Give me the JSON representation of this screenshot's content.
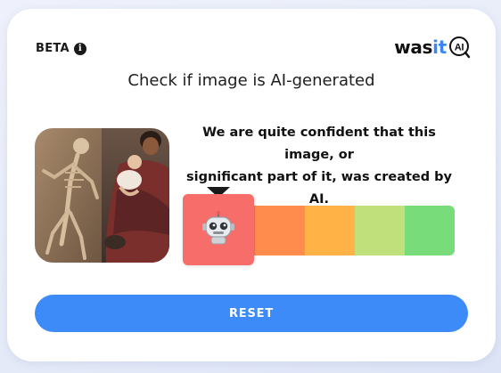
{
  "header": {
    "beta_label": "BETA",
    "info_glyph": "i",
    "logo_part1": "was",
    "logo_part2": "it",
    "logo_badge": "AI"
  },
  "title": "Check if image is AI-generated",
  "result": {
    "verdict_line1": "We are quite confident that this image, or",
    "verdict_line2": "significant part of it, was created by AI.",
    "meter_level": 1,
    "meter_levels_total": 5,
    "meter_colors": [
      "#f76d6a",
      "#ff8c4c",
      "#ffb347",
      "#bfe07a",
      "#78dc7a"
    ],
    "indicator_icon": "robot-icon"
  },
  "image": {
    "icon": "uploaded-image-thumbnail"
  },
  "actions": {
    "reset_label": "RESET"
  },
  "colors": {
    "accent": "#3d8bf8",
    "text": "#111111"
  }
}
